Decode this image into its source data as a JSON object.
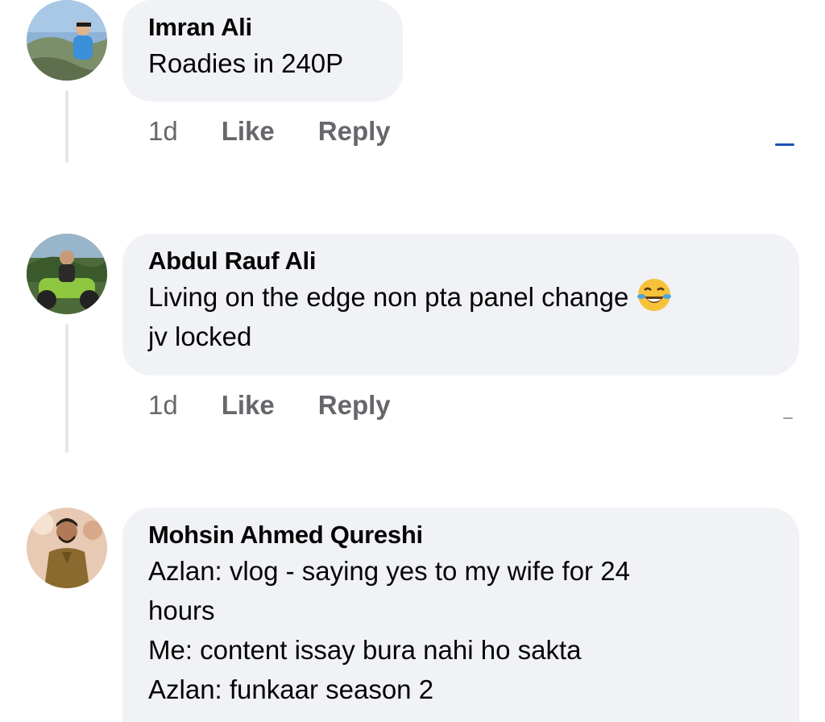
{
  "comments": [
    {
      "author": "Imran Ali",
      "text": "Roadies in 240P",
      "time": "1d",
      "like_label": "Like",
      "reply_label": "Reply",
      "avatar": "photo of man in blue shirt outdoors"
    },
    {
      "author": "Abdul Rauf Ali",
      "text": "Living on the edge non pta panel change",
      "emoji": "face-with-tears-of-joy-icon",
      "text_cont": "jv locked",
      "time": "1d",
      "like_label": "Like",
      "reply_label": "Reply",
      "avatar": "photo of man on green motorcycle"
    },
    {
      "author": "Mohsin Ahmed Qureshi",
      "text": "Azlan: vlog - saying yes to my wife for 24\nhours\nMe: content issay bura nahi ho sakta\nAzlan: funkaar season 2",
      "avatar": "photo of man in brown sherwani"
    }
  ],
  "colors": {
    "bubble": "#f0f2f5",
    "meta": "#65676b",
    "text": "#050505",
    "thread_line": "#e4e6eb"
  }
}
